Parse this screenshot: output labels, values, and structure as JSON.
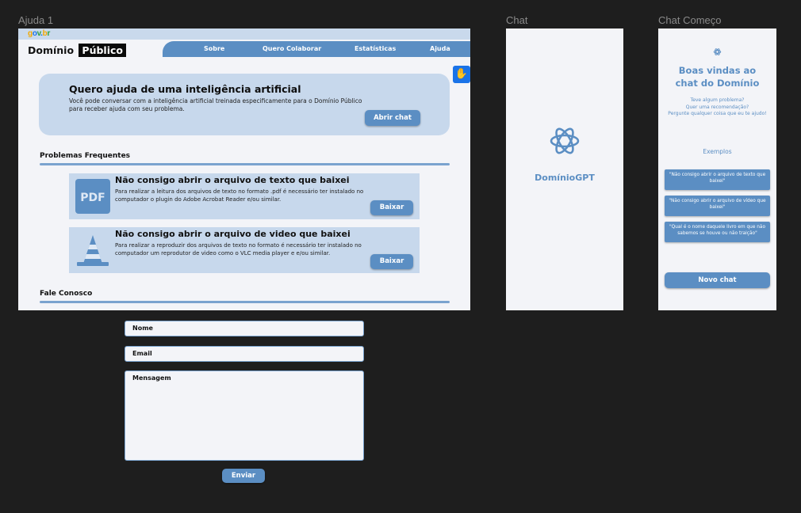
{
  "frames": {
    "ajuda_label": "Ajuda 1",
    "chat_label": "Chat",
    "chat_start_label": "Chat Começo"
  },
  "header": {
    "gov_logo": "gov.br",
    "brand_part1": "Domínio",
    "brand_part2": "Público",
    "nav": [
      "Sobre",
      "Quero Colaborar",
      "Estatísticas",
      "Ajuda"
    ]
  },
  "hero": {
    "title": "Quero ajuda de uma inteligência artificial",
    "text": "Você pode conversar com a inteligência artificial treinada especificamente para o Domínio Público para receber ajuda com seu problema.",
    "button": "Abrir chat"
  },
  "faq": {
    "title": "Problemas Frequentes",
    "items": [
      {
        "title": "Não consigo abrir o arquivo de texto que baixei",
        "text": "Para realizar a leitura dos arquivos de texto no formato .pdf é necessário ter instalado no computador o plugin do Adobe Acrobat Reader e/ou similar.",
        "button": "Baixar",
        "icon": "pdf-icon",
        "icon_text": "PDF"
      },
      {
        "title": "Não consigo abrir o arquivo de video que baixei",
        "text": "Para realizar a reproduzir dos arquivos de texto no formato é necessário ter instalado no computador um reprodutor de video como o VLC media player e e/ou similar.",
        "button": "Baixar",
        "icon": "vlc-cone-icon"
      }
    ]
  },
  "contact": {
    "title": "Fale Conosco",
    "name_placeholder": "Nome",
    "email_placeholder": "Email",
    "message_placeholder": "Mensagem",
    "submit": "Enviar"
  },
  "chat": {
    "name": "DomínioGPT",
    "icon": "openai-logo-icon"
  },
  "chat_start": {
    "welcome_line1": "Boas vindas ao",
    "welcome_line2": "chat do Domínio",
    "sub_line1": "Teve algum problema?",
    "sub_line2": "Quer uma recomendação?",
    "sub_line3": "Pergunte qualquer coisa que eu te ajudo!",
    "examples_title": "Exemplos",
    "examples": [
      "\"Não consigo abrir o arquivo de texto que baixei\"",
      "\"Não consigo abrir o arquivo de vídeo que baixei\"",
      "\"Qual é o nome daquele livro em que não sabemos se houve ou não traição\""
    ],
    "new_chat": "Novo chat"
  },
  "colors": {
    "accent": "#5b8ec3",
    "panel": "#c7d8ec",
    "frame_bg": "#f3f4f8",
    "canvas": "#1e1e1e"
  }
}
